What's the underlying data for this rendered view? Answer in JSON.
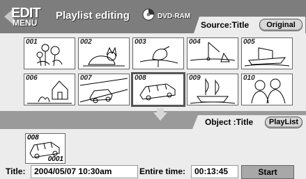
{
  "header": {
    "edit_label": "EDIT",
    "menu_label": "MENU",
    "title": "Playlist editing",
    "disc_label": "DVD-RAM",
    "source_label": "Source:Title",
    "original_button": "Original"
  },
  "thumbnails": [
    {
      "num": "001",
      "icon": "flowers-icon"
    },
    {
      "num": "002",
      "icon": "cat-icon"
    },
    {
      "num": "003",
      "icon": "bird-icon"
    },
    {
      "num": "004",
      "icon": "fishing-icon"
    },
    {
      "num": "005",
      "icon": "ship-icon"
    },
    {
      "num": "006",
      "icon": "house-icon"
    },
    {
      "num": "007",
      "icon": "car-road-icon"
    },
    {
      "num": "008",
      "icon": "car-icon",
      "selected": true
    },
    {
      "num": "009",
      "icon": "sailing-ship-icon"
    },
    {
      "num": "010",
      "icon": "people-icon"
    }
  ],
  "object": {
    "label": "Object :Title",
    "playlist_button": "PlayList",
    "thumb_num": "008",
    "thumb_num2": "0001"
  },
  "info": {
    "title_label": "Title:",
    "title_value": "2004/05/07  10:30am",
    "entire_label": "Entire time:",
    "entire_value": "00:13:45",
    "start_label": "Start"
  },
  "colors": {
    "header_bg": "#7d7d7d",
    "panel_bg": "#ececec",
    "band_bg": "#9a9a9a"
  }
}
